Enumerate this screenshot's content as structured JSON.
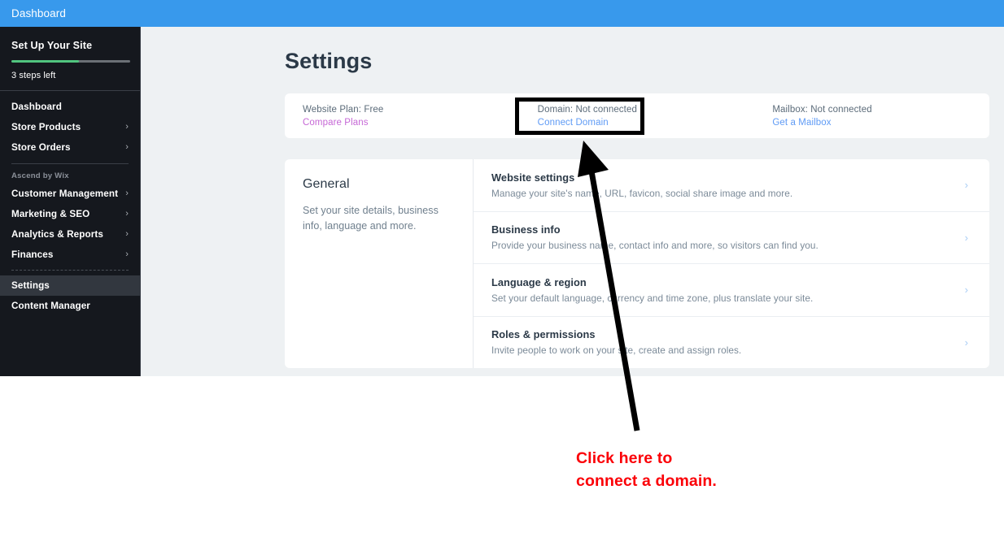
{
  "topbar": {
    "title": "Dashboard",
    "color": "#3899ec"
  },
  "sidebar": {
    "setup": {
      "title": "Set Up Your Site",
      "steps_left": "3 steps left",
      "progress_percent": 57,
      "progress_color": "#51c57f"
    },
    "items": [
      {
        "label": "Dashboard",
        "chevron": "",
        "active": false
      },
      {
        "label": "Store Products",
        "chevron": "›",
        "active": false
      },
      {
        "label": "Store Orders",
        "chevron": "›",
        "active": false
      }
    ],
    "section_label": "Ascend by Wix",
    "ascend_items": [
      {
        "label": "Customer Management",
        "chevron": "›",
        "active": false
      },
      {
        "label": "Marketing & SEO",
        "chevron": "›",
        "active": false
      },
      {
        "label": "Analytics & Reports",
        "chevron": "›",
        "active": false
      },
      {
        "label": "Finances",
        "chevron": "›",
        "active": false
      }
    ],
    "footer_items": [
      {
        "label": "Settings",
        "chevron": "",
        "active": true
      },
      {
        "label": "Content Manager",
        "chevron": "",
        "active": false
      }
    ]
  },
  "main": {
    "page_title": "Settings",
    "status_card": [
      {
        "status": "Website Plan: Free",
        "link": "Compare Plans",
        "link_color": "#c668d6"
      },
      {
        "status": "Domain: Not connected",
        "link": "Connect Domain",
        "link_color": "#5f9bf5"
      },
      {
        "status": "Mailbox: Not connected",
        "link": "Get a Mailbox",
        "link_color": "#5f9bf5"
      }
    ],
    "settings_section": {
      "title": "General",
      "description": "Set your site details, business info, language and more.",
      "rows": [
        {
          "title": "Website settings",
          "description": "Manage your site's name, URL, favicon, social share image and more.",
          "chevron": "›"
        },
        {
          "title": "Business info",
          "description": "Provide your business name, contact info and more, so visitors can find you.",
          "chevron": "›"
        },
        {
          "title": "Language & region",
          "description": "Set your default language, currency and time zone, plus translate your site.",
          "chevron": "›"
        },
        {
          "title": "Roles & permissions",
          "description": "Invite people to work on your site, create and assign roles.",
          "chevron": "›"
        }
      ]
    }
  },
  "annotation": {
    "text": "Click here to\nconnect a domain.",
    "color": "#fb0007",
    "arrow_color": "#000000",
    "highlight_border_color": "#000000"
  }
}
